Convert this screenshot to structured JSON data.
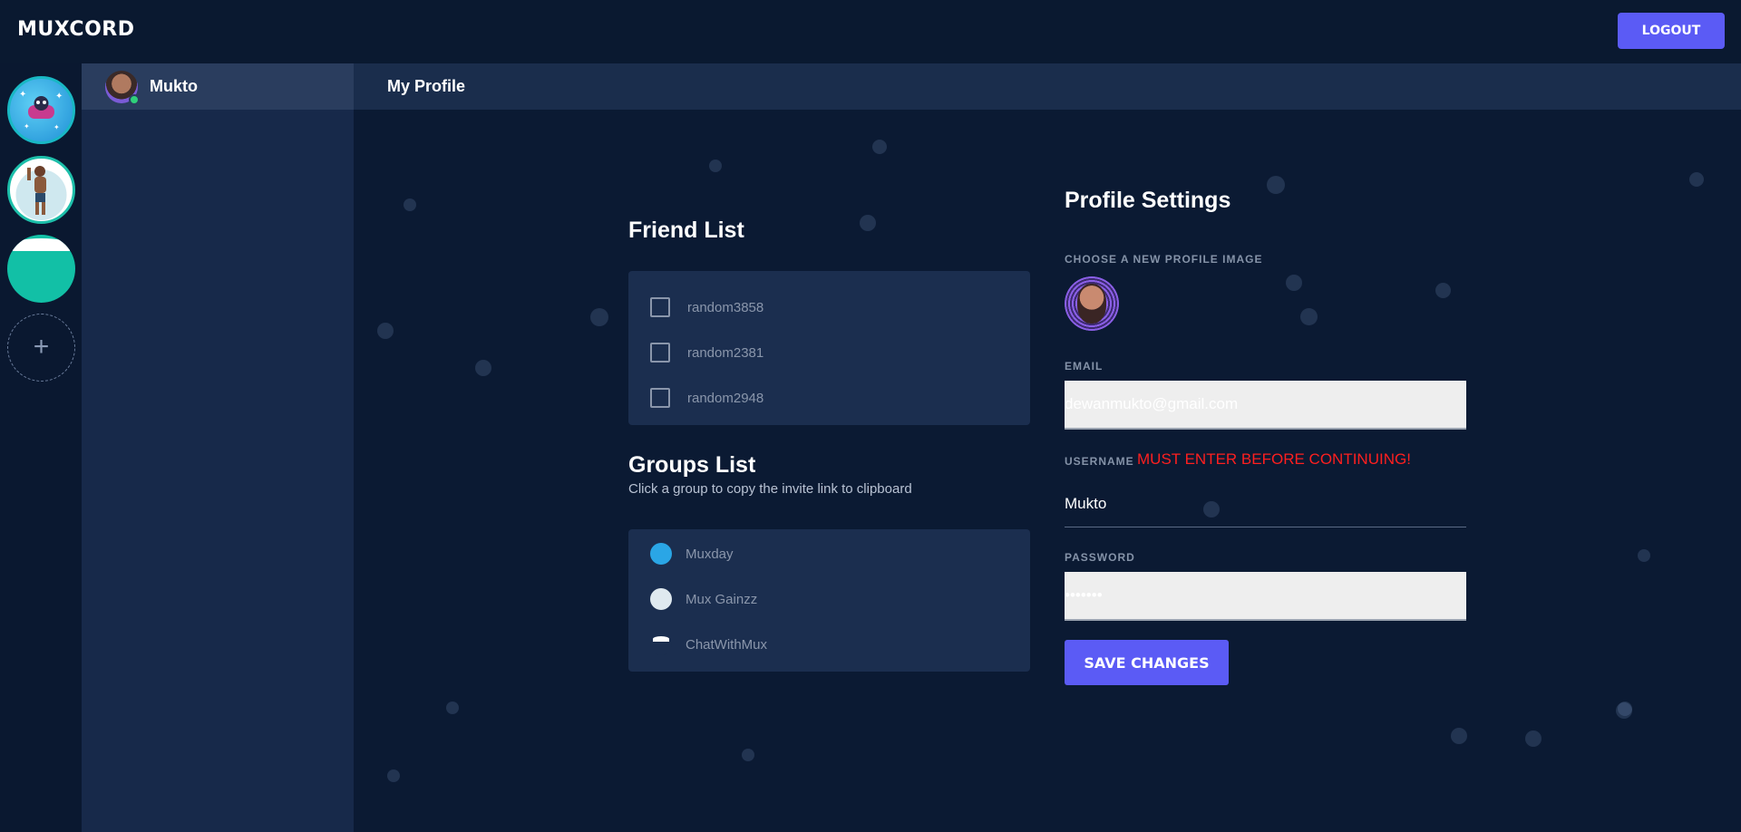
{
  "app": {
    "brand": "MUXCORD",
    "logout_label": "LOGOUT"
  },
  "servers": [
    {
      "name": "Muxday",
      "icon": "game-controller-icon"
    },
    {
      "name": "Mux Gainzz",
      "icon": "bodybuilder-icon"
    },
    {
      "name": "ChatWithMux",
      "icon": "teal-circle-icon"
    }
  ],
  "add_server_icon": "+",
  "user": {
    "name": "Mukto",
    "status": "online"
  },
  "header": {
    "title": "My Profile"
  },
  "friends": {
    "title": "Friend List",
    "items": [
      {
        "name": "random3858",
        "checked": false
      },
      {
        "name": "random2381",
        "checked": false
      },
      {
        "name": "random2948",
        "checked": false
      }
    ]
  },
  "groups": {
    "title": "Groups List",
    "subtitle": "Click a group to copy the invite link to clipboard",
    "items": [
      {
        "name": "Muxday"
      },
      {
        "name": "Mux Gainzz"
      },
      {
        "name": "ChatWithMux"
      }
    ]
  },
  "profile": {
    "title": "Profile Settings",
    "image_label": "CHOOSE A NEW PROFILE IMAGE",
    "email_label": "EMAIL",
    "email_value": "dewanmukto@gmail.com",
    "username_label": "USERNAME",
    "username_error": "MUST ENTER BEFORE CONTINUING!",
    "username_value": "Mukto",
    "password_label": "PASSWORD",
    "password_value": "•••••••",
    "save_label": "SAVE CHANGES"
  },
  "colors": {
    "background": "#0b1a33",
    "accent": "#5b5bf5",
    "panel": "#1b2e4f",
    "error": "#ff1f1f",
    "online": "#2fd07a"
  }
}
